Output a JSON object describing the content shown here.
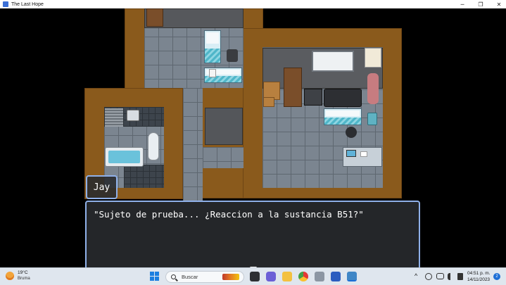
{
  "window": {
    "title": "The Last Hope",
    "minimize": "─",
    "restore": "❐",
    "close": "✕"
  },
  "dialogue": {
    "speaker": "Jay",
    "text": "\"Sujeto de prueba... ¿Reaccion a la sustancia B51?\""
  },
  "taskbar": {
    "weather_temp": "19°C",
    "weather_condition": "Bruma",
    "search_placeholder": "Buscar",
    "tray_chevron": "^",
    "time": "04:51 p. m.",
    "date": "14/11/2023",
    "notification_count": "2"
  },
  "icons": [
    "app-icon",
    "weather-icon",
    "start-icon",
    "search-icon",
    "task-view-icon",
    "chat-icon",
    "file-explorer-icon",
    "chrome-icon",
    "settings-icon",
    "word-icon",
    "game-icon",
    "network-icon",
    "volume-icon",
    "notification-icon"
  ]
}
